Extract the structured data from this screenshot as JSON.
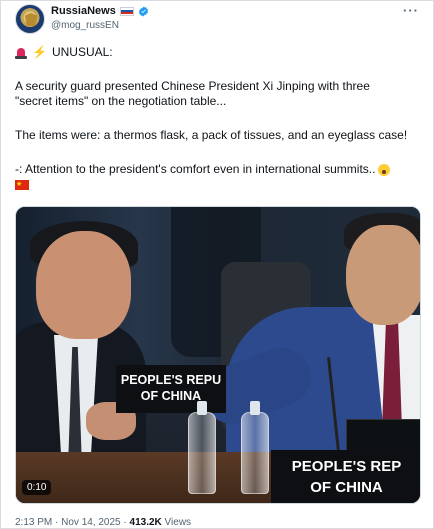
{
  "author": {
    "name": "RussiaNews",
    "handle": "@mog_russEN",
    "verified": true,
    "flag_icon": "russia-flag-icon"
  },
  "tweet": {
    "line1": "UNUSUAL:",
    "line2": "A security guard presented Chinese President Xi Jinping with three",
    "line3": "\"secret items\" on the negotiation table...",
    "line4": "The items were: a thermos flask, a pack of tissues, and an eyeglass case!",
    "line5": "-: Attention to the president's comfort even in international summits..",
    "line1_icons": [
      "siren-icon",
      "lightning-icon"
    ],
    "line5_icons": [
      "astonished-face-icon"
    ],
    "line6_icons": [
      "china-flag-icon"
    ]
  },
  "media": {
    "sign_left": [
      "PEOPLE'S REPU",
      "OF CHINA"
    ],
    "sign_right": [
      "PEOPLE'S REP",
      "OF CHINA"
    ],
    "duration": "0:10"
  },
  "meta": {
    "time": "2:13 PM · Nov 14, 2025 · ",
    "views_count": "413.2K",
    "views_label": " Views"
  },
  "colors": {
    "text": "#0f1419",
    "secondary": "#536471",
    "verified": "#1d9bf0",
    "suit": "#2d4a8f",
    "tie": "#7a1e3a"
  }
}
